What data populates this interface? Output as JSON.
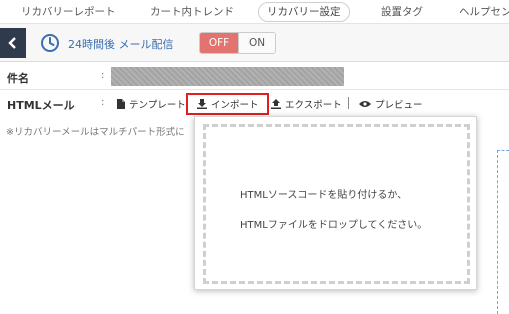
{
  "tabs": [
    {
      "label": "リカバリーレポート",
      "active": false
    },
    {
      "label": "カート内トレンド",
      "active": false
    },
    {
      "label": "リカバリー設定",
      "active": true
    },
    {
      "label": "設置タグ",
      "active": false
    },
    {
      "label": "ヘルプセン",
      "active": false
    }
  ],
  "header": {
    "back_icon": "chevron-left-icon",
    "clock_icon": "clock-icon",
    "delivery_label": "24時間後 メール配信",
    "toggle_off": "OFF",
    "toggle_on": "ON",
    "toggle_state": "OFF"
  },
  "form": {
    "subject_label": "件名",
    "html_label": "HTMLメール",
    "colon": ":"
  },
  "toolbar": {
    "template": "テンプレート",
    "import": "インポート",
    "export": "エクスポート",
    "preview": "プレビュー",
    "separator": "|"
  },
  "note": "※リカバリーメールはマルチパート形式に",
  "popup": {
    "line1": "HTMLソースコードを貼り付けるか、",
    "line2": "HTMLファイルをドロップしてください。"
  },
  "colors": {
    "accent_off": "#e3736f",
    "dark_nav": "#2f3b4c",
    "link_blue": "#3a6fb0",
    "highlight": "#e02020"
  }
}
